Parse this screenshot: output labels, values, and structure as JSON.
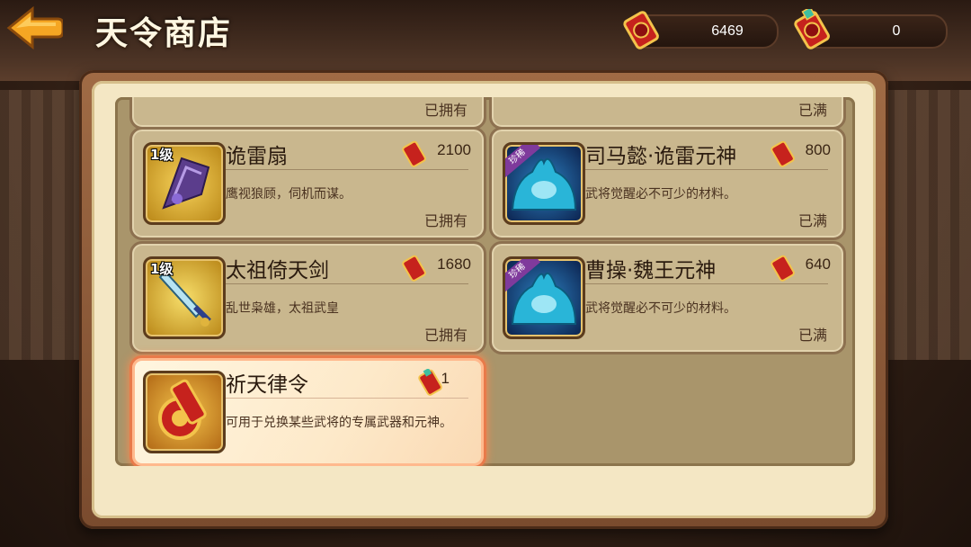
{
  "header": {
    "title": "天令商店",
    "currency_1": {
      "amount": "6469",
      "icon": "token-icon"
    },
    "currency_2": {
      "amount": "0",
      "icon": "qitian-token-icon"
    }
  },
  "top_partial": {
    "left_status": "已拥有",
    "right_status": "已满"
  },
  "items": [
    {
      "name": "诡雷扇",
      "price": "2100",
      "desc": "鹰视狼顾，伺机而谋。",
      "status": "已拥有",
      "level": "1级",
      "icon": "fan-icon"
    },
    {
      "name": "司马懿·诡雷元神",
      "price": "800",
      "desc": "武将觉醒必不可少的材料。",
      "status": "已满",
      "badge": "珍稀",
      "icon": "spirit-icon"
    },
    {
      "name": "太祖倚天剑",
      "price": "1680",
      "desc": "乱世枭雄，太祖武皇",
      "status": "已拥有",
      "level": "1级",
      "icon": "sword-icon"
    },
    {
      "name": "曹操·魏王元神",
      "price": "640",
      "desc": "武将觉醒必不可少的材料。",
      "status": "已满",
      "badge": "珍稀",
      "icon": "spirit-icon"
    },
    {
      "name": "祈天律令",
      "price": "1",
      "desc": "可用于兑换某些武将的专属武器和元神。",
      "status": "",
      "icon": "decree-icon"
    }
  ],
  "colors": {
    "accent": "#e87a4a",
    "card": "#c9b78e",
    "panel": "#f4e7c4"
  }
}
